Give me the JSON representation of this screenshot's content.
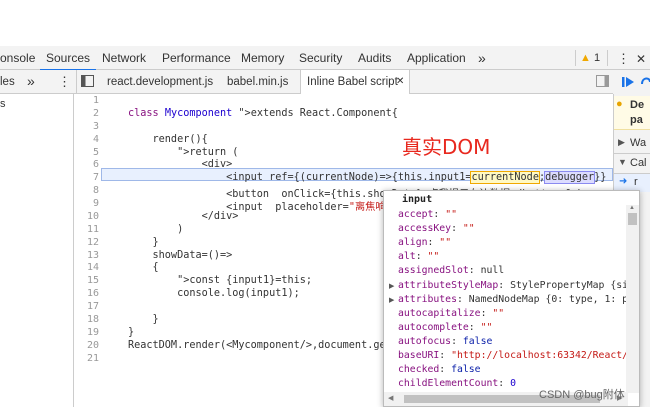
{
  "tabs": [
    {
      "label": "onsole",
      "active": false
    },
    {
      "label": "Sources",
      "active": true
    },
    {
      "label": "Network",
      "active": false
    },
    {
      "label": "Performance",
      "active": false
    },
    {
      "label": "Memory",
      "active": false
    },
    {
      "label": "Security",
      "active": false
    },
    {
      "label": "Audits",
      "active": false
    },
    {
      "label": "Application",
      "active": false
    }
  ],
  "tabs_more": "»",
  "warning_count": "1",
  "kebab": "⋮",
  "close": "✕",
  "nav": {
    "label": "les",
    "more": "»",
    "menu": "⋮",
    "left_char": "s"
  },
  "file_tabs": {
    "tab1": "react.development.js",
    "tab2": "babel.min.js",
    "tab3": "Inline Babel script",
    "tab3_close": "✕"
  },
  "editor": {
    "line_numbers": [
      "1",
      "2",
      "3",
      "4",
      "5",
      "6",
      "7",
      "8",
      "9",
      "10",
      "11",
      "12",
      "13",
      "14",
      "15",
      "16",
      "17",
      "18",
      "19",
      "20",
      "21"
    ],
    "lines": [
      "",
      "class Mycomponent extends React.Component{",
      "",
      "    render(){",
      "        return (",
      "            <div>",
      "                <input ref={(currentNode)=>{this.input1=currentNode;debugger}} typ",
      "                <button  onClick={this.showData}>点我提示左边数据</button>&nbsp;",
      "                <input  placeholder=\"离焦响应",
      "            </div>",
      "        )",
      "    }",
      "    showData=()=>",
      "    {",
      "        const {input1}=this;",
      "        console.log(input1);",
      "",
      "    }",
      "}",
      "ReactDOM.render(<Mycomponent/>,document.getE",
      ""
    ]
  },
  "annotation": "真实DOM",
  "popover": {
    "title": "input",
    "props": [
      {
        "key": "accept",
        "value": "\"\"",
        "type": "str",
        "expandable": false
      },
      {
        "key": "accessKey",
        "value": "\"\"",
        "type": "str",
        "expandable": false
      },
      {
        "key": "align",
        "value": "\"\"",
        "type": "str",
        "expandable": false
      },
      {
        "key": "alt",
        "value": "\"\"",
        "type": "str",
        "expandable": false
      },
      {
        "key": "assignedSlot",
        "value": "null",
        "type": "obj",
        "expandable": false
      },
      {
        "key": "attributeStyleMap",
        "value": "StylePropertyMap {siz",
        "type": "obj",
        "expandable": true
      },
      {
        "key": "attributes",
        "value": "NamedNodeMap {0: type, 1: pl",
        "type": "obj",
        "expandable": true
      },
      {
        "key": "autocapitalize",
        "value": "\"\"",
        "type": "str",
        "expandable": false
      },
      {
        "key": "autocomplete",
        "value": "\"\"",
        "type": "str",
        "expandable": false
      },
      {
        "key": "autofocus",
        "value": "false",
        "type": "kw",
        "expandable": false
      },
      {
        "key": "baseURI",
        "value": "\"http://localhost:63342/React/w",
        "type": "str",
        "expandable": false
      },
      {
        "key": "checked",
        "value": "false",
        "type": "kw",
        "expandable": false
      },
      {
        "key": "childElementCount",
        "value": "0",
        "type": "num",
        "expandable": false
      }
    ]
  },
  "right_pane": {
    "pause_text_1": "De",
    "pause_text_2": "pa",
    "watch": "Wa",
    "callstack": "Cal",
    "frame": "r"
  },
  "watermark": "CSDN @bug附体"
}
